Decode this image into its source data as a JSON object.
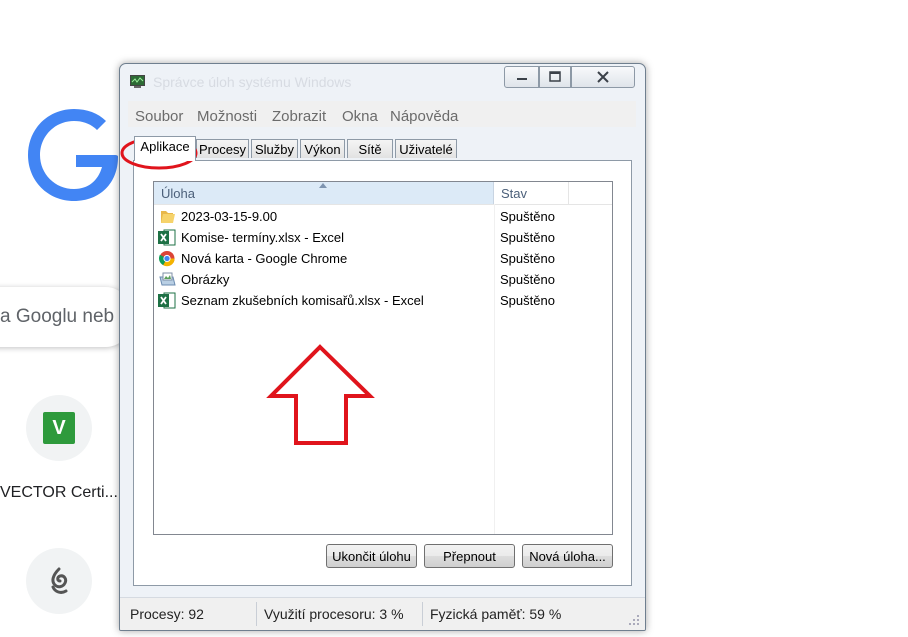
{
  "browser": {
    "search_placeholder": "a Googlu neb",
    "shortcut_1": {
      "label": "VECTOR Certi...",
      "badge": "V"
    },
    "shortcut_2": {
      "icon": "swirl-logo-icon"
    }
  },
  "window": {
    "title": "Správce úloh systému Windows",
    "menu": [
      "Soubor",
      "Možnosti",
      "Zobrazit",
      "Okna",
      "Nápověda"
    ],
    "tabs": [
      "Aplikace",
      "Procesy",
      "Služby",
      "Výkon",
      "Sítě",
      "Uživatelé"
    ],
    "active_tab": "Aplikace",
    "columns": {
      "task": "Úloha",
      "status": "Stav"
    },
    "rows": [
      {
        "name": "2023-03-15-9.00",
        "status": "Spuštěno",
        "icon": "folder-icon"
      },
      {
        "name": "Komise- termíny.xlsx - Excel",
        "status": "Spuštěno",
        "icon": "excel-icon"
      },
      {
        "name": "Nová karta - Google Chrome",
        "status": "Spuštěno",
        "icon": "chrome-icon"
      },
      {
        "name": "Obrázky",
        "status": "Spuštěno",
        "icon": "pictures-library-icon"
      },
      {
        "name": "Seznam zkušebních komisařů.xlsx - Excel",
        "status": "Spuštěno",
        "icon": "excel-icon"
      }
    ],
    "buttons": {
      "end_task": "Ukončit úlohu",
      "switch_to": "Přepnout",
      "new_task": "Nová úloha..."
    },
    "statusbar": {
      "processes": "Procesy: 92",
      "cpu": "Využití procesoru: 3 %",
      "memory": "Fyzická paměť: 59 %"
    }
  },
  "annotation_colors": {
    "highlight": "#e0141c"
  }
}
